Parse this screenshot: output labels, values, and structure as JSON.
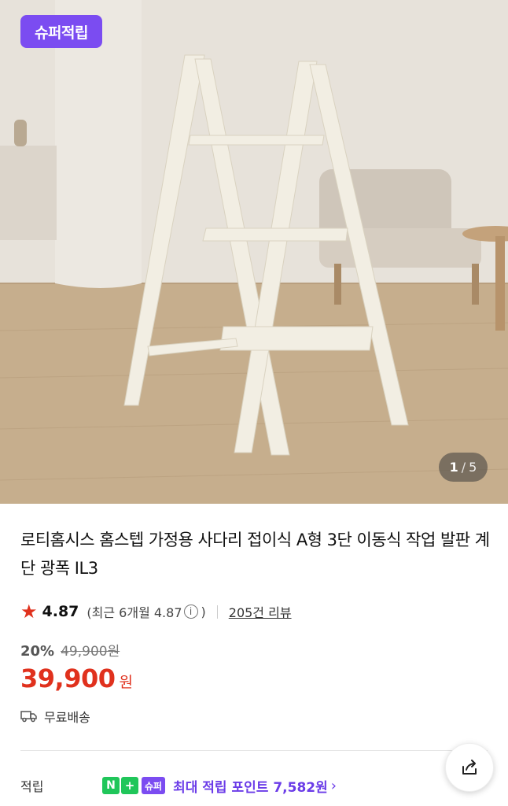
{
  "hero": {
    "badge_label": "슈퍼적립",
    "counter_current": "1",
    "counter_separator": "/",
    "counter_total": "5"
  },
  "product": {
    "title": "로티홈시스 홈스텝 가정용 사다리 접이식 A형 3단 이동식 작업 발판 계단 광폭 IL3",
    "rating": "4.87",
    "recent_rating_prefix": "(최근 6개월 4.87",
    "recent_rating_suffix": ")",
    "info_icon_glyph": "i",
    "review_link": "205건 리뷰"
  },
  "price": {
    "discount": "20%",
    "original": "49,900원",
    "sale": "39,900",
    "currency": "원"
  },
  "shipping": {
    "label": "무료배송"
  },
  "points": {
    "label": "적립",
    "n_badge": "N",
    "plus_badge": "+",
    "super_badge": "슈퍼",
    "text": "최대 적립 포인트 7,582원",
    "chevron": "›"
  },
  "colors": {
    "accent_purple": "#7b4cf1",
    "price_red": "#e0311d",
    "naver_green": "#20c65a"
  },
  "icons": [
    "truck-icon",
    "share-icon",
    "star-icon",
    "info-icon",
    "chevron-right-icon"
  ]
}
